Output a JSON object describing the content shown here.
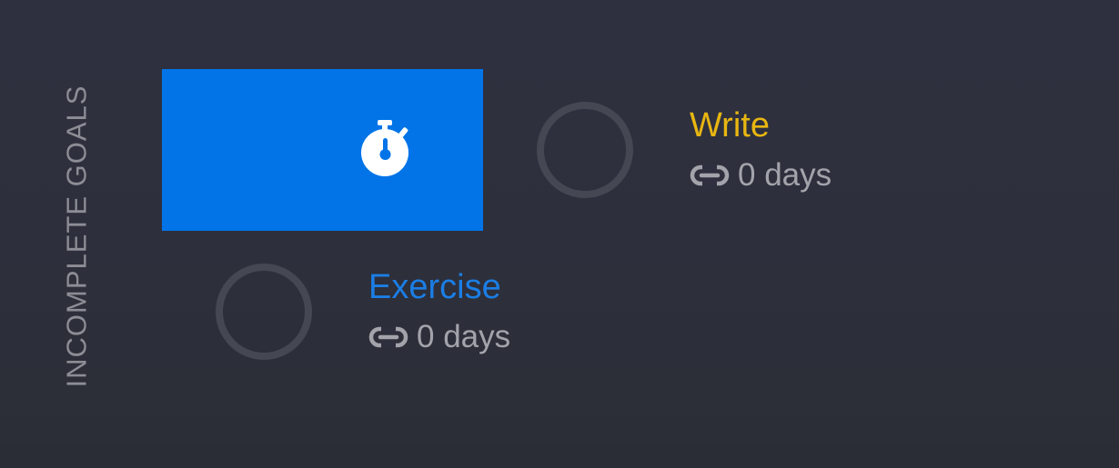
{
  "section": {
    "label": "INCOMPLETE GOALS"
  },
  "timer_tile": {
    "icon": "stopwatch-icon",
    "color": "#0274e8"
  },
  "goals": [
    {
      "title": "Write",
      "title_color": "#e8b612",
      "streak_icon": "link-icon",
      "streak": "0 days"
    },
    {
      "title": "Exercise",
      "title_color": "#1b7ee5",
      "streak_icon": "link-icon",
      "streak": "0 days"
    }
  ]
}
